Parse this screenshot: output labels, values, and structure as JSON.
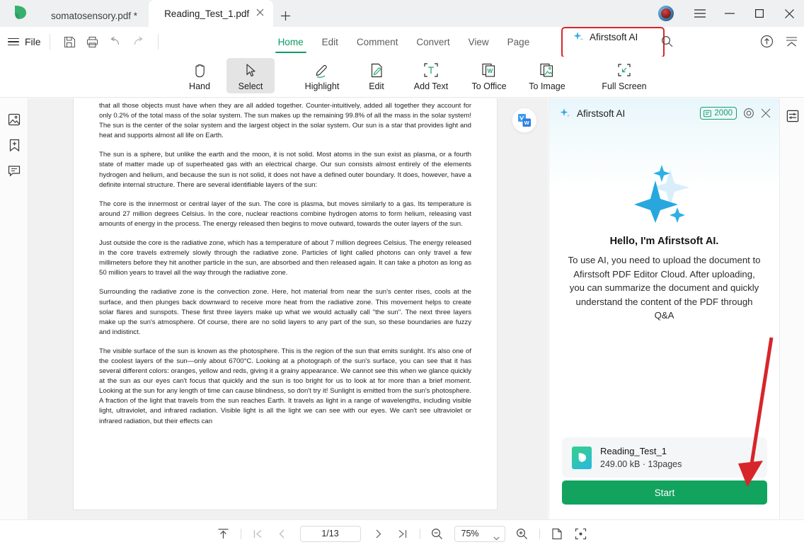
{
  "window": {
    "tabs": [
      {
        "label": "somatosensory.pdf *",
        "active": false
      },
      {
        "label": "Reading_Test_1.pdf",
        "active": true
      }
    ],
    "new_tab_icon": "plus-icon",
    "controls": {
      "menu": "hamburger-icon",
      "minimize": "minimize-icon",
      "maximize": "maximize-icon",
      "close": "close-icon"
    }
  },
  "menubar": {
    "file_label": "File",
    "quick_actions": [
      "save-icon",
      "print-icon",
      "undo-icon",
      "redo-icon"
    ],
    "ribbon_tabs": [
      {
        "label": "Home",
        "active": true
      },
      {
        "label": "Edit",
        "active": false
      },
      {
        "label": "Comment",
        "active": false
      },
      {
        "label": "Convert",
        "active": false
      },
      {
        "label": "View",
        "active": false
      },
      {
        "label": "Page",
        "active": false
      }
    ],
    "ai_entry_label": "Afirstsoft AI",
    "search_icon": "search-icon",
    "cloud_icon": "cloud-upload-icon",
    "collapse_icon": "collapse-ribbon-icon",
    "highlight_color": "#d7262a"
  },
  "ribbon": {
    "tools": [
      {
        "label": "Hand",
        "icon": "hand-icon",
        "active": false
      },
      {
        "label": "Select",
        "icon": "cursor-icon",
        "active": true
      },
      {
        "label": "Highlight",
        "icon": "highlighter-icon",
        "active": false
      },
      {
        "label": "Edit",
        "icon": "edit-page-icon",
        "active": false
      },
      {
        "label": "Add Text",
        "icon": "add-text-icon",
        "active": false
      },
      {
        "label": "To Office",
        "icon": "to-word-icon",
        "active": false
      },
      {
        "label": "To Image",
        "icon": "to-image-icon",
        "active": false
      },
      {
        "label": "Full Screen",
        "icon": "full-screen-icon",
        "active": false
      }
    ]
  },
  "left_rail": {
    "items": [
      {
        "name": "thumbnails-icon"
      },
      {
        "name": "bookmark-add-icon"
      },
      {
        "name": "comments-icon"
      }
    ]
  },
  "document": {
    "floating_button_icon": "convert-to-word-icon",
    "paragraphs": [
      "that all those objects must have when they are all added together. Counter-intuitively, added all together they account for only 0.2% of the total mass of the solar system. The sun makes up the remaining 99.8% of all the mass in the solar system! The sun is the center of the solar system and the largest object in the solar system. Our sun is a star that provides light and heat and supports almost all life on Earth.",
      "The sun is a sphere, but unlike the earth and the moon, it is not solid. Most atoms in the sun exist as plasma, or a fourth state of matter made up of superheated gas with an electrical charge. Our sun consists almost entirely of the elements hydrogen and helium, and because the sun is not solid, it does not have a defined outer boundary. It does, however, have a definite internal structure. There are several identifiable layers of the sun:",
      "The core is the innermost or central layer of the sun. The core is plasma, but moves similarly to a gas. Its temperature is around 27 million degrees Celsius. In the core, nuclear reactions combine hydrogen atoms to form helium, releasing vast amounts of energy in the process. The energy released then begins to move outward, towards the outer layers of the sun.",
      "Just outside the core is the radiative zone, which has a temperature of about 7 million degrees Celsius. The energy released in the core travels extremely slowly through the radiative zone. Particles of light called photons can only travel a few millimeters before they hit another particle in the sun, are absorbed and then released again. It can take a photon as long as 50 million years to travel all the way through the radiative zone.",
      "Surrounding the radiative zone is the convection zone. Here, hot material from near the sun's center rises, cools at the surface, and then plunges back downward to receive more heat from the radiative zone. This movement helps to create solar flares and sunspots. These first three layers make up what we would actually call \"the sun\". The next three layers make up the sun's atmosphere. Of course, there are no solid layers to any part of the sun, so these boundaries are fuzzy and indistinct.",
      "The visible surface of the sun is known as the photosphere. This is the region of the sun that emits sunlight. It's also one of the coolest layers of the sun—only about 6700°C. Looking at a photograph of the sun's surface, you can see that it has several different colors: oranges, yellow and reds, giving it a grainy appearance. We cannot see this when we glance quickly at the sun as our eyes can't focus that quickly and the sun is too bright for us to look at for more than a brief moment. Looking at the sun for any length of time can cause blindness, so don't try it! Sunlight is emitted from the sun's photosphere. A fraction of the light that travels from the sun reaches Earth. It travels as light in a range of wavelengths, including visible light, ultraviolet, and infrared radiation. Visible light is all the light we can see with our eyes. We can't see ultraviolet or infrared radiation, but their effects can"
    ]
  },
  "ai_panel": {
    "header_title": "Afirstsoft AI",
    "token_count": "2000",
    "token_icon": "token-icon",
    "history_icon": "history-icon",
    "close_icon": "close-icon",
    "hello": "Hello, I'm Afirstsoft AI.",
    "description": "To use AI, you need to upload the document to Afirstsoft PDF Editor Cloud. After uploading, you can summarize the document and quickly understand the content of the PDF through Q&A",
    "file": {
      "name": "Reading_Test_1",
      "meta": "249.00 kB · 13pages",
      "icon": "pdf-file-icon"
    },
    "start_label": "Start",
    "start_color": "#12a35f"
  },
  "right_rail": {
    "items": [
      {
        "name": "properties-icon"
      }
    ]
  },
  "bottom_bar": {
    "scroll_top_icon": "scroll-to-top-icon",
    "first_page_icon": "first-page-icon",
    "prev_page_icon": "prev-page-icon",
    "page_indicator": "1/13",
    "next_page_icon": "next-page-icon",
    "last_page_icon": "last-page-icon",
    "zoom_out_icon": "zoom-out-icon",
    "zoom_level": "75%",
    "zoom_in_icon": "zoom-in-icon",
    "single_page_icon": "single-page-icon",
    "fit-page_icon": "fit-page-icon"
  },
  "annotation": {
    "arrow_color": "#d7262a"
  }
}
